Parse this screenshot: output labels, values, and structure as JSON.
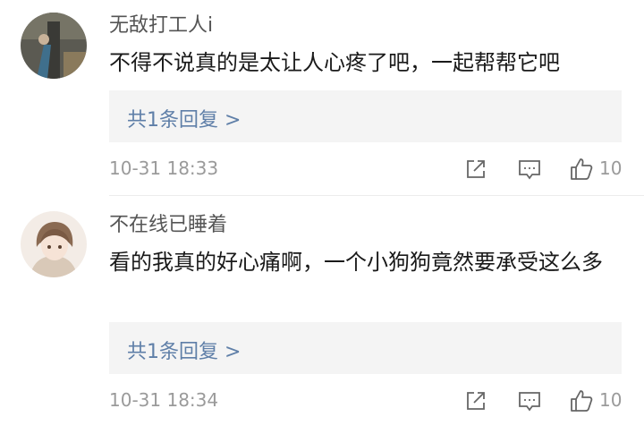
{
  "comments": [
    {
      "username": "无敌打工人i",
      "text": "不得不说真的是太让人心疼了吧，一起帮帮它吧",
      "replies_label": "共1条回复 >",
      "time": "10-31 18:33",
      "likes": "10"
    },
    {
      "username": "不在线已睡着",
      "text": "看的我真的好心痛啊，一个小狗狗竟然要承受这么多",
      "replies_label": "共1条回复 >",
      "time": "10-31 18:34",
      "likes": "10"
    }
  ],
  "icons": {
    "share": "share-icon",
    "reply": "comment-icon",
    "like": "thumbs-up-icon"
  }
}
